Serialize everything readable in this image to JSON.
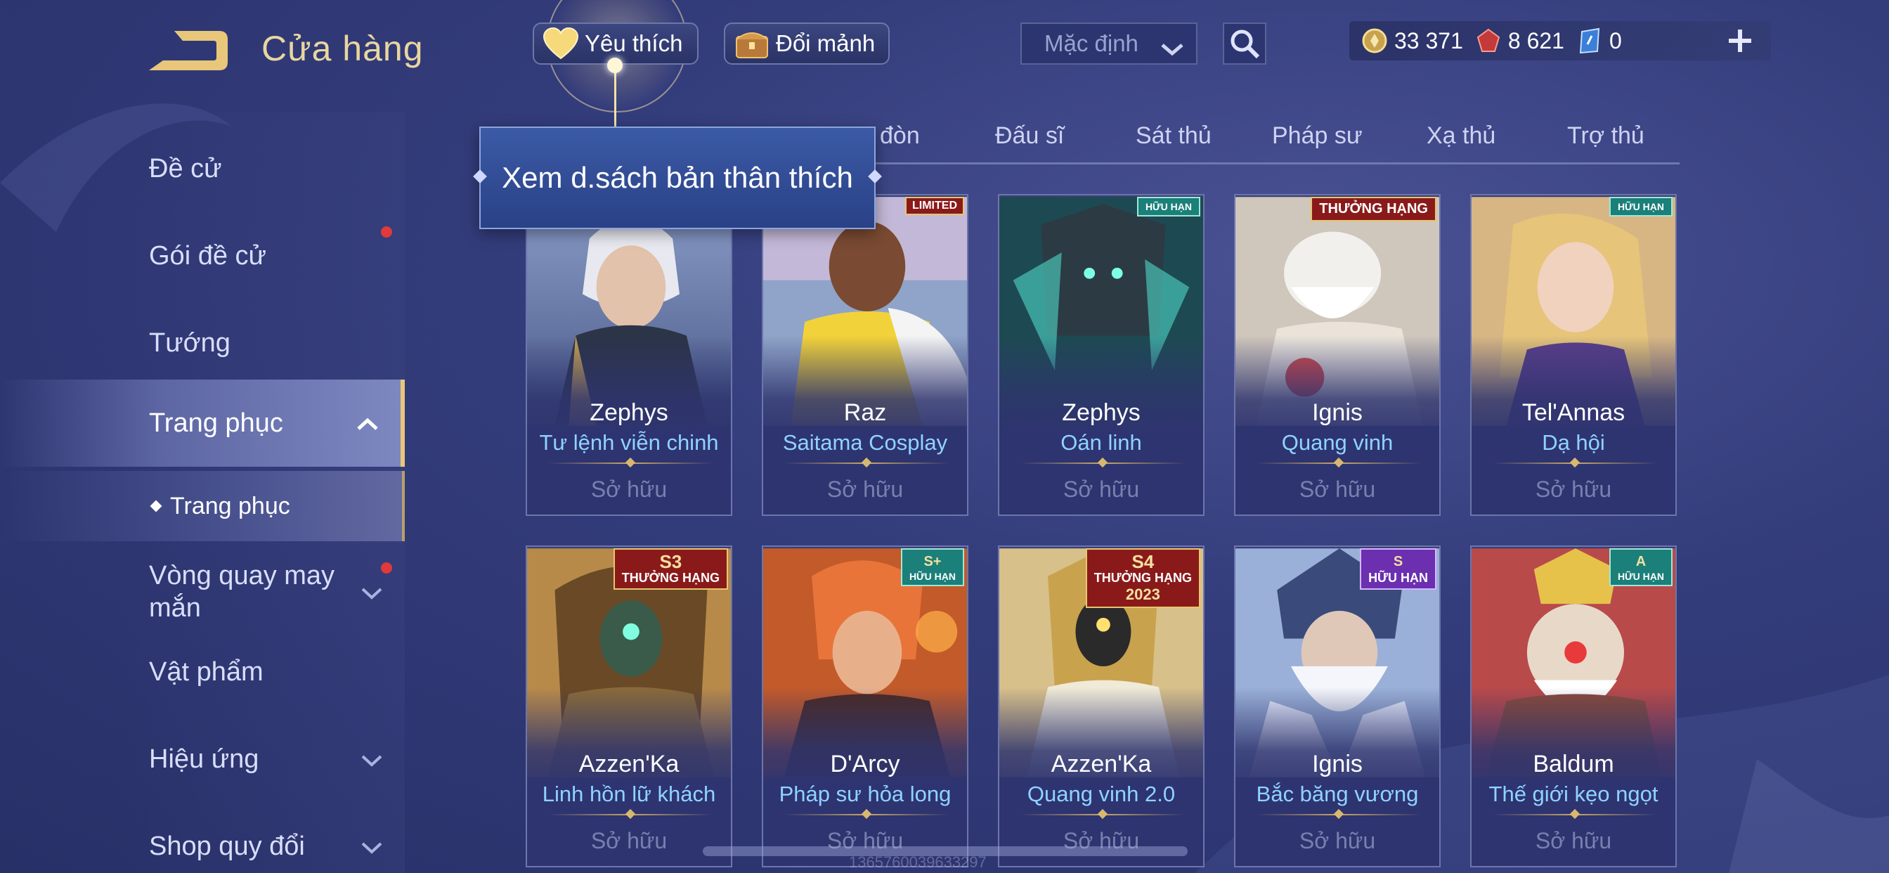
{
  "header": {
    "title": "Cửa hàng",
    "favorite_label": "Yêu thích",
    "shard_label": "Đổi mảnh",
    "sort_value": "Mặc định"
  },
  "currency": [
    {
      "name": "gold-coin",
      "value": "33 371"
    },
    {
      "name": "red-gem",
      "value": "8 621"
    },
    {
      "name": "voucher",
      "value": "0"
    }
  ],
  "tooltip": "Xem d.sách bản thân thích",
  "sidebar": {
    "items": [
      {
        "label": "Đề cử",
        "has_dot": false,
        "chevron": false
      },
      {
        "label": "Gói đề cử",
        "has_dot": true,
        "chevron": false
      },
      {
        "label": "Tướng",
        "has_dot": false,
        "chevron": false
      },
      {
        "label": "Trang phục",
        "active": true,
        "chevron": "up"
      },
      {
        "label": "Trang phục",
        "sub": true
      },
      {
        "label": "Vòng quay may mắn",
        "has_dot": true,
        "chevron": "down"
      },
      {
        "label": "Vật phẩm",
        "has_dot": false,
        "chevron": false
      },
      {
        "label": "Hiệu ứng",
        "chevron": "down"
      },
      {
        "label": "Shop quy đổi",
        "chevron": "down"
      }
    ]
  },
  "tabs": [
    "đòn",
    "Đấu sĩ",
    "Sát thủ",
    "Pháp sư",
    "Xạ thủ",
    "Trợ thủ"
  ],
  "cards": [
    {
      "hero": "Zephys",
      "skin": "Tư lệnh viễn chinh",
      "status": "Sở hữu",
      "badge": ""
    },
    {
      "hero": "Raz",
      "skin": "Saitama Cosplay",
      "status": "Sở hữu",
      "badge": "LIMITED"
    },
    {
      "hero": "Zephys",
      "skin": "Oán linh",
      "status": "Sở hữu",
      "badge": "HỮU HẠN"
    },
    {
      "hero": "Ignis",
      "skin": "Quang vinh",
      "status": "Sở hữu",
      "badge": "THƯỞNG HẠNG"
    },
    {
      "hero": "Tel'Annas",
      "skin": "Dạ hội",
      "status": "Sở hữu",
      "badge": "HỮU HẠN"
    },
    {
      "hero": "Azzen'Ka",
      "skin": "Linh hồn lữ khách",
      "status": "Sở hữu",
      "badge": "THƯỞNG HẠNG",
      "badge_top": "S3"
    },
    {
      "hero": "D'Arcy",
      "skin": "Pháp sư hỏa long",
      "status": "Sở hữu",
      "badge": "HỮU HẠN",
      "badge_top": "S+"
    },
    {
      "hero": "Azzen'Ka",
      "skin": "Quang vinh 2.0",
      "status": "Sở hữu",
      "badge": "THƯỞNG HẠNG",
      "badge_top": "S4",
      "badge_bottom": "2023"
    },
    {
      "hero": "Ignis",
      "skin": "Bắc băng vương",
      "status": "Sở hữu",
      "badge": "HỮU HẠN",
      "badge_top": "S"
    },
    {
      "hero": "Baldum",
      "skin": "Thế giới kẹo ngọt",
      "status": "Sở hữu",
      "badge": "HỮU HẠN",
      "badge_top": "A"
    }
  ],
  "footer_id": "1365760039633297",
  "colors": {
    "accent_gold": "#e8c77a",
    "skin_name": "#8fd3ff",
    "bg": "#343d7c"
  }
}
